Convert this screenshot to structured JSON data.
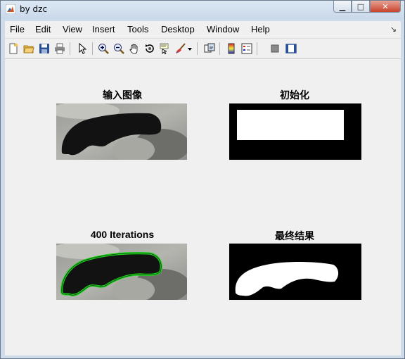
{
  "window": {
    "title": "by dzc",
    "controls": {
      "minimize": "▁",
      "maximize": "□",
      "close": "✕"
    }
  },
  "menubar": {
    "items": [
      "File",
      "Edit",
      "View",
      "Insert",
      "Tools",
      "Desktop",
      "Window",
      "Help"
    ],
    "overflow_icon": "dock-arrow-icon"
  },
  "toolbar": {
    "buttons": [
      "new-figure-icon",
      "open-file-icon",
      "save-icon",
      "print-icon",
      "edit-plot-arrow-icon",
      "zoom-in-icon",
      "zoom-out-icon",
      "pan-hand-icon",
      "rotate-3d-icon",
      "data-cursor-icon",
      "brush-icon",
      "link-plot-icon",
      "colorbar-icon",
      "legend-icon",
      "hide-plot-tools-icon",
      "show-plot-tools-icon"
    ]
  },
  "figure": {
    "panels": [
      {
        "title": "输入图像"
      },
      {
        "title": "初始化"
      },
      {
        "title": "400 Iterations"
      },
      {
        "title": "最终结果"
      }
    ]
  },
  "colors": {
    "contour": "#1ed31e",
    "figure_bg": "#f0f0f0",
    "mask": "#ffffff"
  }
}
